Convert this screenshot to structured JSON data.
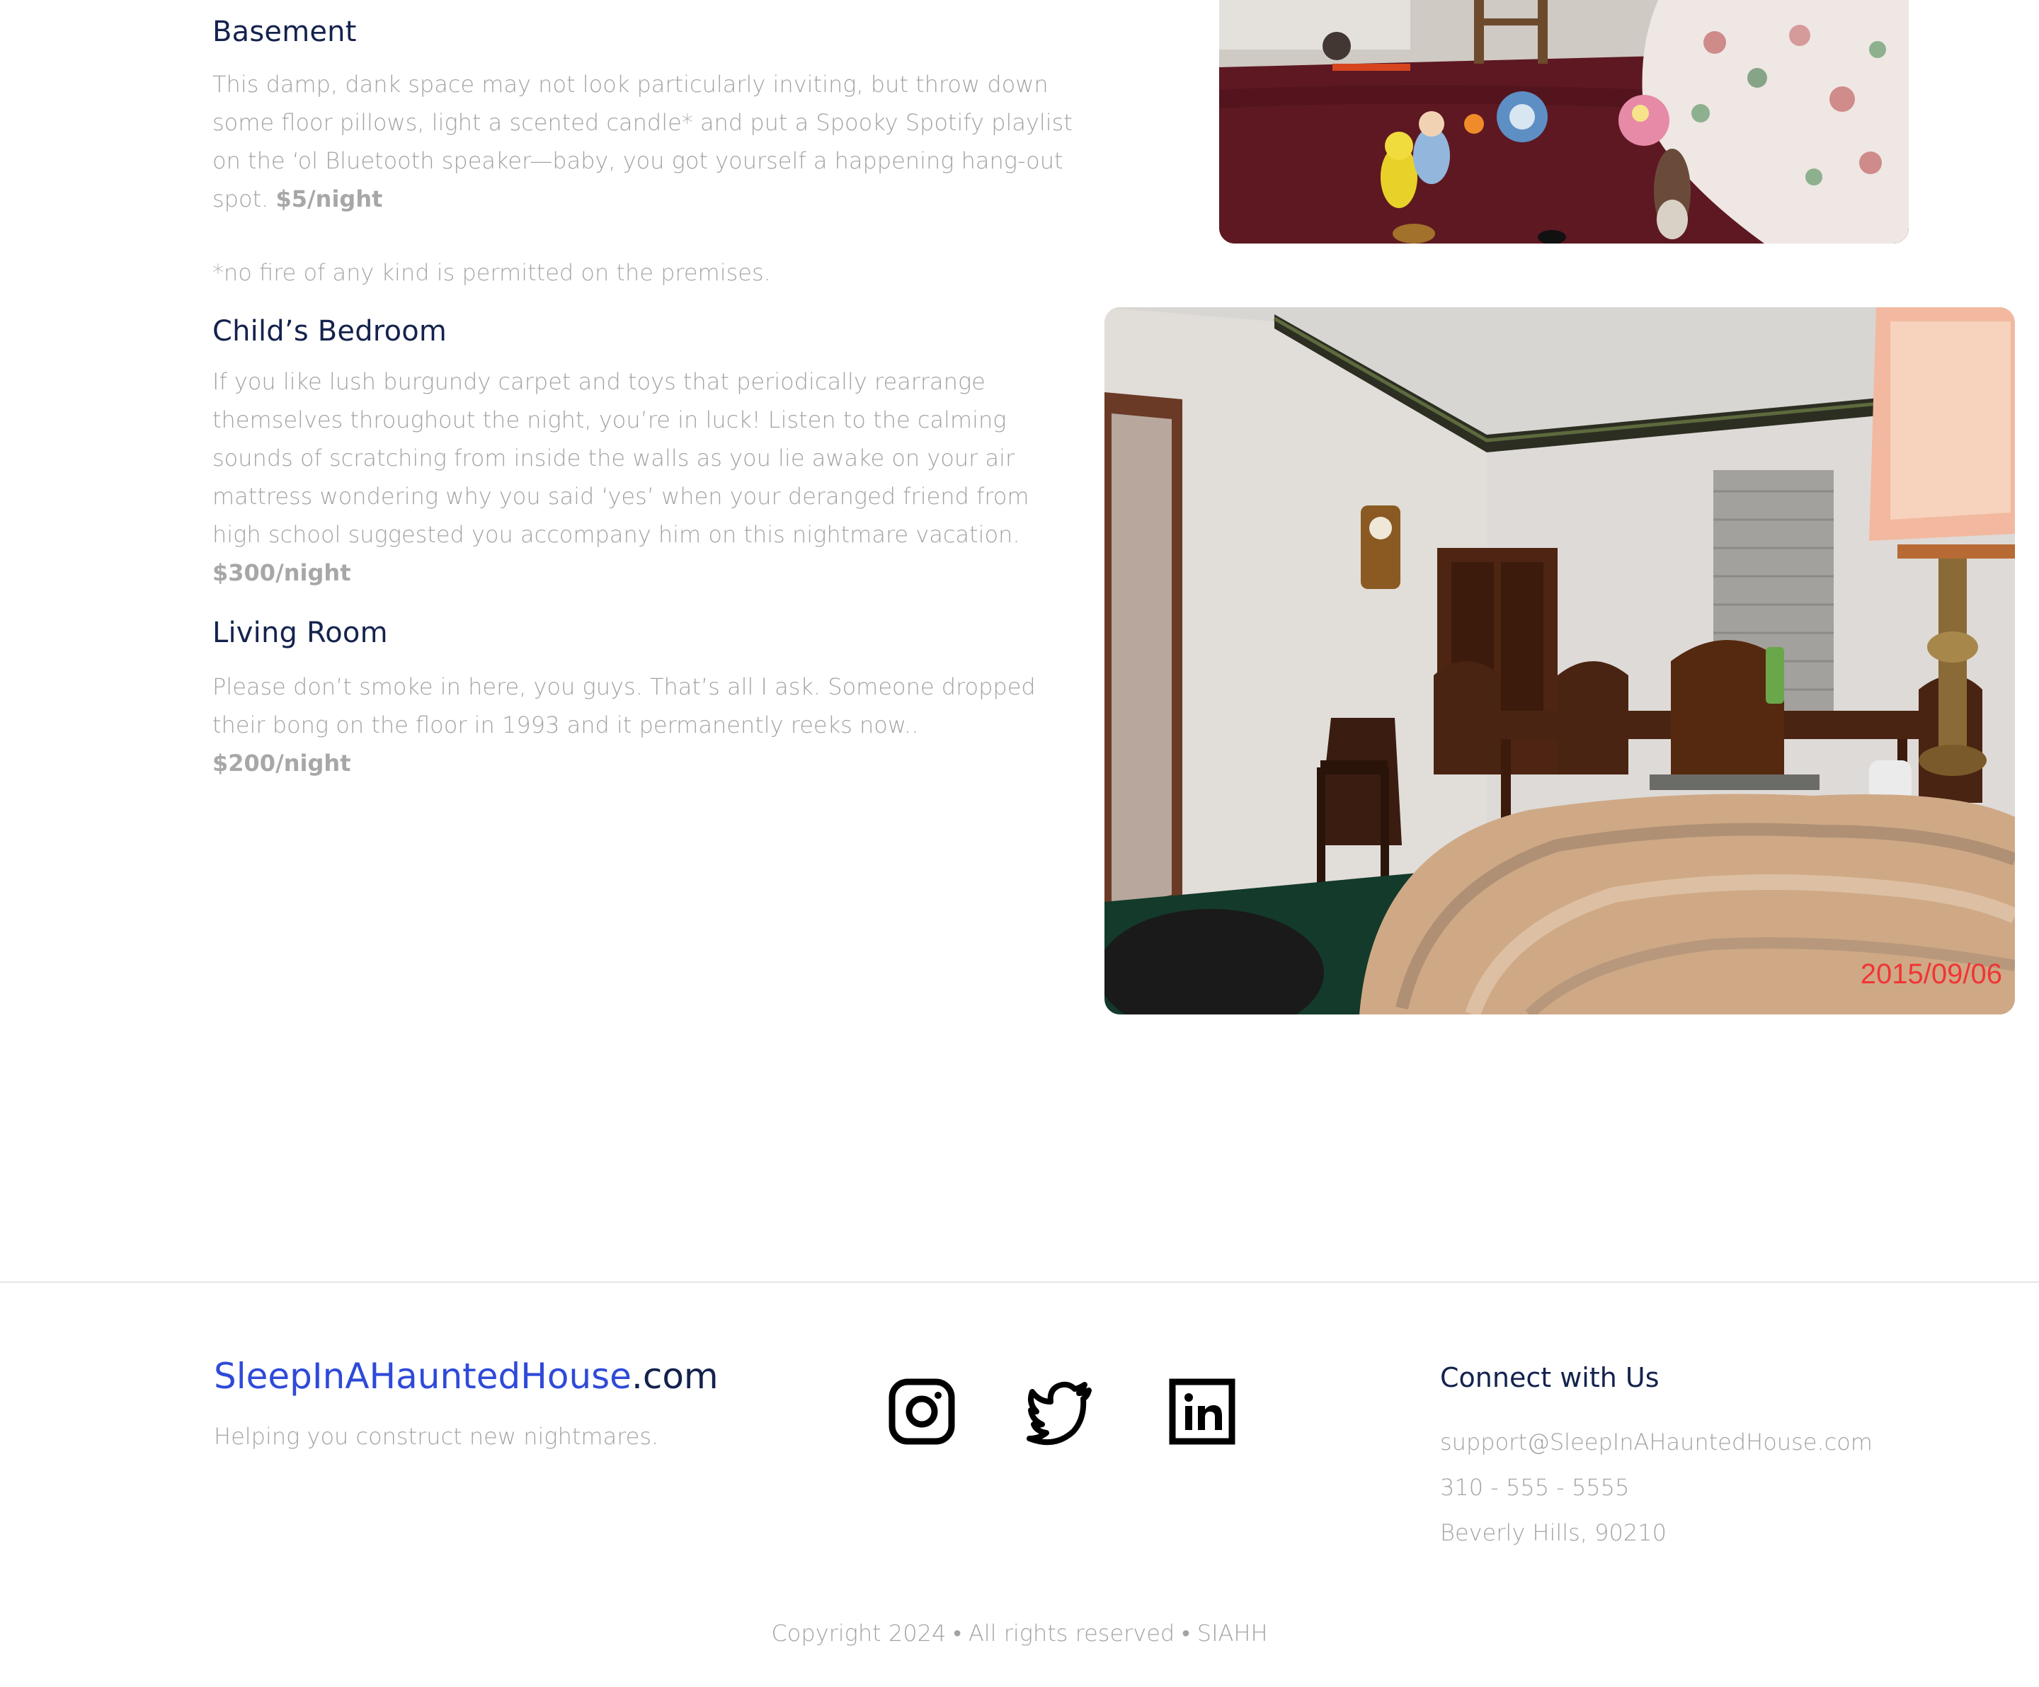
{
  "rooms": [
    {
      "title": "Basement",
      "description": "This damp, dank space may not look particularly inviting, but throw down some floor pillows, light a scented candle* and put a Spooky Spotify playlist on the ‘ol Bluetooth speaker—baby, you got yourself a happening hang-out spot.",
      "price": "$5/night",
      "note": "*no fire of any kind is permitted on the premises."
    },
    {
      "title": "Child’s Bedroom",
      "description": "If you like lush burgundy carpet and toys that periodically rearrange themselves throughout the night, you’re in luck! Listen to the calming sounds of scratching from inside the walls as you lie awake on your air mattress wondering why you said ‘yes’ when your deranged friend from high school suggested you accompany him on this nightmare vacation.",
      "price": "$300/night"
    },
    {
      "title": "Living Room",
      "description": "Please don’t smoke in here, you guys. That’s all I ask. Someone dropped their bong on the floor in 1993 and it permanently reeks now..",
      "price": "$200/night"
    }
  ],
  "photos": {
    "living_room_timestamp": "2015/09/06"
  },
  "footer": {
    "brand_main": "SleepInAHauntedHouse",
    "brand_suffix": ".com",
    "tagline": "Helping you construct new nightmares.",
    "social": [
      "instagram-icon",
      "twitter-icon",
      "linkedin-icon"
    ],
    "connect_title": "Connect with Us",
    "email": "support@SleepInAHauntedHouse.com",
    "phone": "310 - 555 - 5555",
    "address": "Beverly Hills, 90210",
    "copyright": "Copyright 2024 • All rights reserved • SIAHH"
  },
  "colors": {
    "heading": "#14224d",
    "brand_blue": "#2f4ad9",
    "body_text": "#a3a3a3"
  }
}
